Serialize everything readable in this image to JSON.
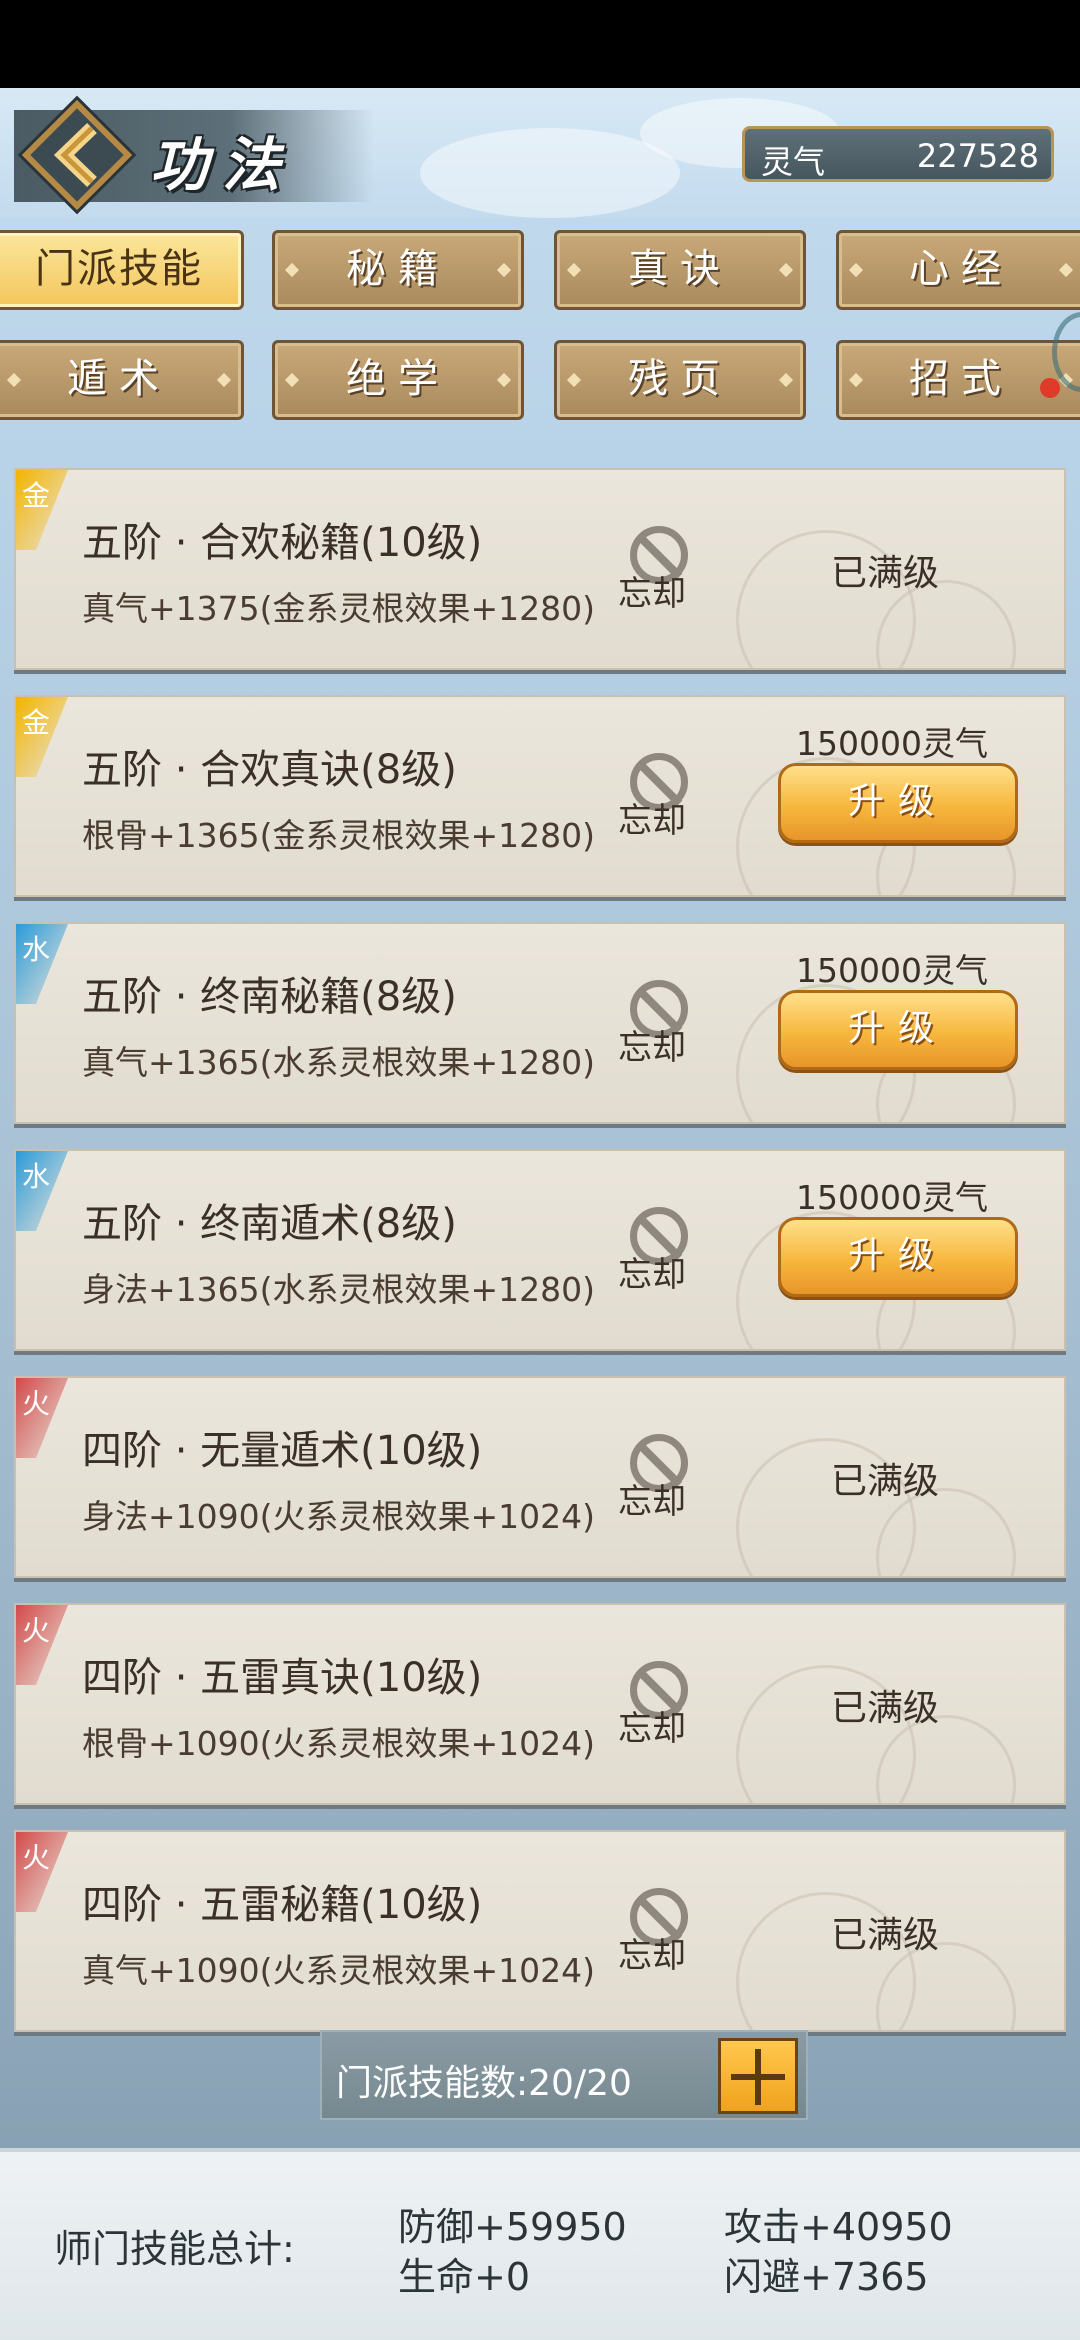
{
  "header": {
    "title": "功法",
    "currency_label": "灵气",
    "currency_value": "227528"
  },
  "tabs": [
    {
      "label": "门派技能",
      "active": true
    },
    {
      "label": "秘籍",
      "active": false
    },
    {
      "label": "真诀",
      "active": false
    },
    {
      "label": "心经",
      "active": false
    },
    {
      "label": "遁术",
      "active": false
    },
    {
      "label": "绝学",
      "active": false
    },
    {
      "label": "残页",
      "active": false
    },
    {
      "label": "招式",
      "active": false
    }
  ],
  "skills": [
    {
      "element": "金",
      "element_color": "#f2b400",
      "name": "五阶 · 合欢秘籍(10级)",
      "effect": "真气+1375(金系灵根效果+1280)",
      "forget": "忘却",
      "status": "已满级"
    },
    {
      "element": "金",
      "element_color": "#f2b400",
      "name": "五阶 · 合欢真诀(8级)",
      "effect": "根骨+1365(金系灵根效果+1280)",
      "forget": "忘却",
      "cost": "150000灵气",
      "button": "升级"
    },
    {
      "element": "水",
      "element_color": "#2a9ad8",
      "name": "五阶 · 终南秘籍(8级)",
      "effect": "真气+1365(水系灵根效果+1280)",
      "forget": "忘却",
      "cost": "150000灵气",
      "button": "升级"
    },
    {
      "element": "水",
      "element_color": "#2a9ad8",
      "name": "五阶 · 终南遁术(8级)",
      "effect": "身法+1365(水系灵根效果+1280)",
      "forget": "忘却",
      "cost": "150000灵气",
      "button": "升级"
    },
    {
      "element": "火",
      "element_color": "#d24a4a",
      "name": "四阶 · 无量遁术(10级)",
      "effect": "身法+1090(火系灵根效果+1024)",
      "forget": "忘却",
      "status": "已满级"
    },
    {
      "element": "火",
      "element_color": "#d24a4a",
      "name": "四阶 · 五雷真诀(10级)",
      "effect": "根骨+1090(火系灵根效果+1024)",
      "forget": "忘却",
      "status": "已满级"
    },
    {
      "element": "火",
      "element_color": "#d24a4a",
      "name": "四阶 · 五雷秘籍(10级)",
      "effect": "真气+1090(火系灵根效果+1024)",
      "forget": "忘却",
      "status": "已满级"
    }
  ],
  "skill_count": "门派技能数:20/20",
  "totals": {
    "label": "师门技能总计:",
    "defense": "防御+59950",
    "attack": "攻击+40950",
    "life": "生命+0",
    "dodge": "闪避+7365"
  }
}
